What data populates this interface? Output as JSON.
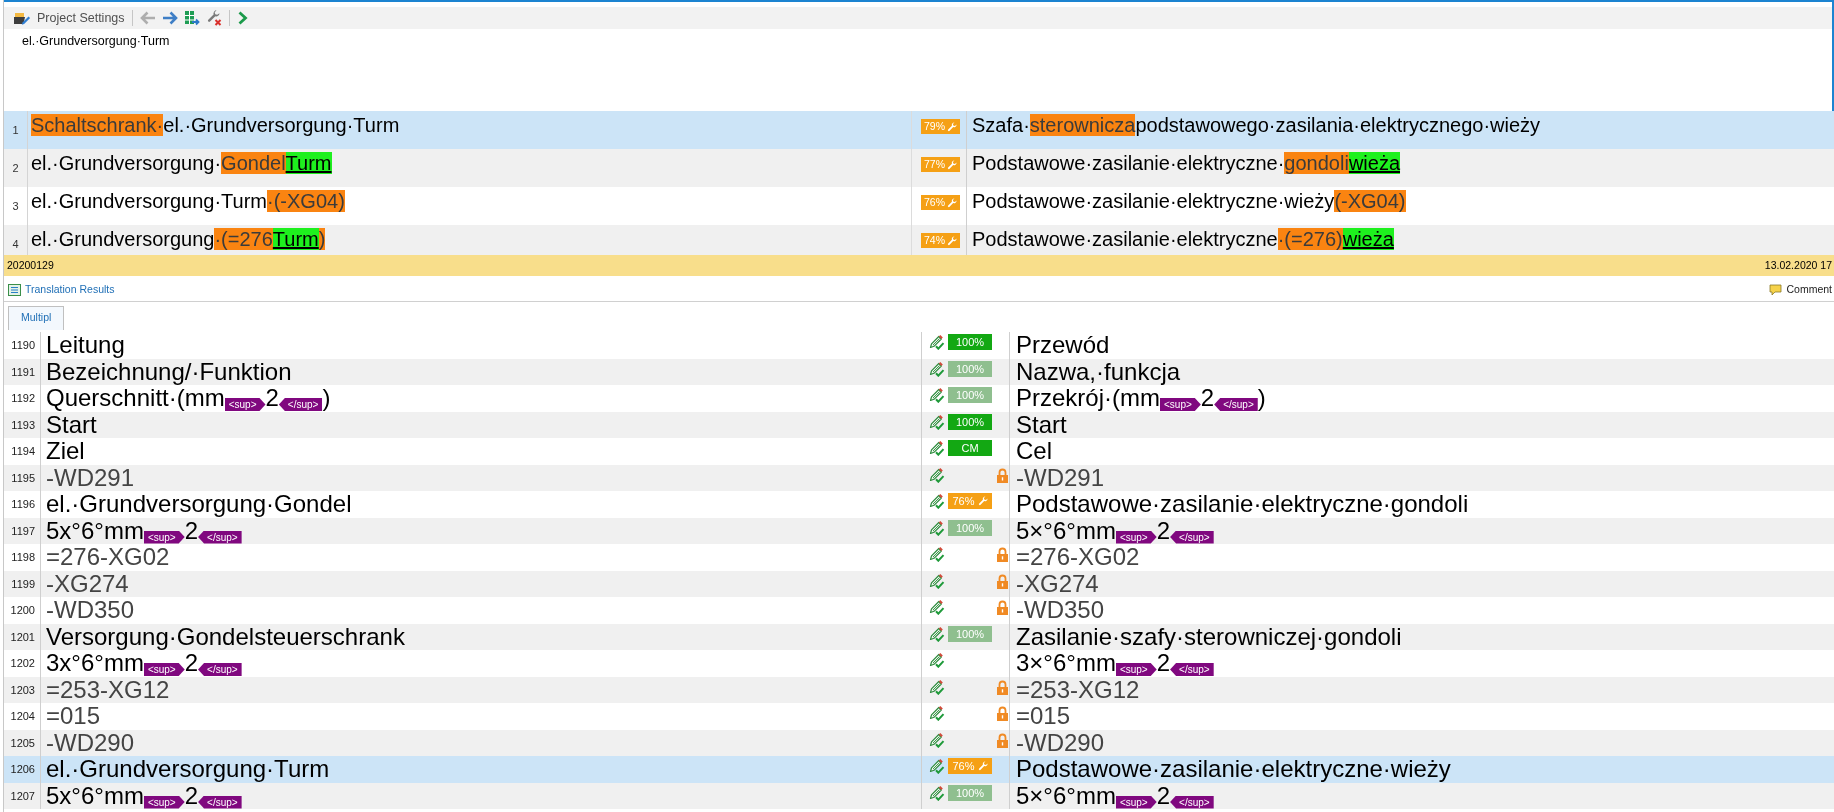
{
  "toolbar": {
    "settings_label": "Project Settings",
    "buttons": [
      {
        "kind": "back",
        "disabled": true
      },
      {
        "kind": "forward",
        "disabled": false
      },
      {
        "kind": "apply",
        "disabled": false
      },
      {
        "kind": "remove",
        "disabled": false
      },
      {
        "kind": "next",
        "disabled": false
      }
    ]
  },
  "source_preview": "el.·Grundversorgung·Turm",
  "results": [
    {
      "number": "1",
      "selected": true,
      "source": [
        {
          "kind": "changed",
          "text": "Schaltschrank·"
        },
        {
          "kind": "plain",
          "text": "el.·Grundversorgung·Turm"
        }
      ],
      "score": {
        "kind": "fuzzy",
        "text": "79%"
      },
      "target": [
        {
          "kind": "plain",
          "text": "Szafa·"
        },
        {
          "kind": "changed",
          "text": "sterownicza"
        },
        {
          "kind": "plain",
          "text": "podstawowego·zasilania·elektrycznego·wieży"
        }
      ]
    },
    {
      "number": "2",
      "selected": false,
      "source": [
        {
          "kind": "plain",
          "text": "el.·Grundversorgung·"
        },
        {
          "kind": "changed",
          "text": "Gondel"
        },
        {
          "kind": "inserted",
          "text": "Turm"
        }
      ],
      "score": {
        "kind": "fuzzy",
        "text": "77%"
      },
      "target": [
        {
          "kind": "plain",
          "text": "Podstawowe·zasilanie·elektryczne·"
        },
        {
          "kind": "changed",
          "text": "gondoli"
        },
        {
          "kind": "inserted",
          "text": "wieża"
        }
      ]
    },
    {
      "number": "3",
      "selected": false,
      "source": [
        {
          "kind": "plain",
          "text": "el.·Grundversorgung·Turm"
        },
        {
          "kind": "changed",
          "text": "·(-XG04)"
        }
      ],
      "score": {
        "kind": "fuzzy",
        "text": "76%"
      },
      "target": [
        {
          "kind": "plain",
          "text": "Podstawowe·zasilanie·elektryczne·wieży"
        },
        {
          "kind": "changed",
          "text": "(-XG04)"
        }
      ]
    },
    {
      "number": "4",
      "selected": false,
      "source": [
        {
          "kind": "plain",
          "text": "el.·Grundversorgung"
        },
        {
          "kind": "changed",
          "text": "·(=276"
        },
        {
          "kind": "inserted",
          "text": "Turm"
        },
        {
          "kind": "changed",
          "text": ")"
        }
      ],
      "score": {
        "kind": "fuzzy",
        "text": "74%"
      },
      "target": [
        {
          "kind": "plain",
          "text": "Podstawowe·zasilanie·elektryczne"
        },
        {
          "kind": "changed",
          "text": "·(=276)"
        },
        {
          "kind": "inserted",
          "text": "wieża"
        }
      ]
    }
  ],
  "info_bar": {
    "segment_id": "20200129",
    "date": "13.02.2020 17"
  },
  "panel_tabs": [
    {
      "label": "Translation Results",
      "selected": true
    },
    {
      "label": "Comment",
      "selected": false
    }
  ],
  "document_tabs": [
    {
      "label": "Multipl",
      "selected": true
    }
  ],
  "segments": [
    {
      "number": "1190",
      "selected": false,
      "locked": false,
      "source": [
        {
          "kind": "plain",
          "text": "Leitung"
        }
      ],
      "badge": {
        "kind": "exact",
        "text": "100%",
        "color": "#13a813"
      },
      "target": [
        {
          "kind": "plain",
          "text": "Przewód"
        }
      ]
    },
    {
      "number": "1191",
      "selected": false,
      "locked": false,
      "source": [
        {
          "kind": "plain",
          "text": "Bezeichnung/·Funktion"
        }
      ],
      "badge": {
        "kind": "exact",
        "text": "100%",
        "color": "#8fbf8f"
      },
      "target": [
        {
          "kind": "plain",
          "text": "Nazwa,·funkcja"
        }
      ]
    },
    {
      "number": "1192",
      "selected": false,
      "locked": false,
      "source": [
        {
          "kind": "plain",
          "text": "Querschnitt·(mm"
        },
        {
          "kind": "tag_open",
          "text": "<sup>"
        },
        {
          "kind": "plain",
          "text": "2"
        },
        {
          "kind": "tag_close",
          "text": "</sup>"
        },
        {
          "kind": "plain",
          "text": ")"
        }
      ],
      "badge": {
        "kind": "exact",
        "text": "100%",
        "color": "#8fbf8f"
      },
      "target": [
        {
          "kind": "plain",
          "text": "Przekrój·(mm"
        },
        {
          "kind": "tag_open",
          "text": "<sup>"
        },
        {
          "kind": "plain",
          "text": "2"
        },
        {
          "kind": "tag_close",
          "text": "</sup>"
        },
        {
          "kind": "plain",
          "text": ")"
        }
      ]
    },
    {
      "number": "1193",
      "selected": false,
      "locked": false,
      "source": [
        {
          "kind": "plain",
          "text": "Start"
        }
      ],
      "badge": {
        "kind": "exact",
        "text": "100%",
        "color": "#13a813"
      },
      "target": [
        {
          "kind": "plain",
          "text": "Start"
        }
      ]
    },
    {
      "number": "1194",
      "selected": false,
      "locked": false,
      "source": [
        {
          "kind": "plain",
          "text": "Ziel"
        }
      ],
      "badge": {
        "kind": "exact",
        "text": "CM",
        "color": "#13a813"
      },
      "target": [
        {
          "kind": "plain",
          "text": "Cel"
        }
      ]
    },
    {
      "number": "1195",
      "selected": false,
      "locked": true,
      "source": [
        {
          "kind": "plain",
          "text": "-WD291"
        }
      ],
      "target": [
        {
          "kind": "plain",
          "text": "-WD291"
        }
      ]
    },
    {
      "number": "1196",
      "selected": false,
      "locked": false,
      "source": [
        {
          "kind": "plain",
          "text": "el.·Grundversorgung·Gondel"
        }
      ],
      "badge": {
        "kind": "fuzzy",
        "text": "76%",
        "color": "#f5a015"
      },
      "target": [
        {
          "kind": "plain",
          "text": "Podstawowe·zasilanie·elektryczne·gondoli"
        }
      ]
    },
    {
      "number": "1197",
      "selected": false,
      "locked": false,
      "source": [
        {
          "kind": "plain",
          "text": "5x°6°mm"
        },
        {
          "kind": "tag_open",
          "text": "<sup>"
        },
        {
          "kind": "plain",
          "text": "2"
        },
        {
          "kind": "tag_close",
          "text": "</sup>"
        }
      ],
      "badge": {
        "kind": "exact",
        "text": "100%",
        "color": "#8fbf8f"
      },
      "target": [
        {
          "kind": "plain",
          "text": "5×°6°mm"
        },
        {
          "kind": "tag_open",
          "text": "<sup>"
        },
        {
          "kind": "plain",
          "text": "2"
        },
        {
          "kind": "tag_close",
          "text": "</sup>"
        }
      ]
    },
    {
      "number": "1198",
      "selected": false,
      "locked": true,
      "source": [
        {
          "kind": "plain",
          "text": "=276-XG02"
        }
      ],
      "target": [
        {
          "kind": "plain",
          "text": "=276-XG02"
        }
      ]
    },
    {
      "number": "1199",
      "selected": false,
      "locked": true,
      "source": [
        {
          "kind": "plain",
          "text": "-XG274"
        }
      ],
      "target": [
        {
          "kind": "plain",
          "text": "-XG274"
        }
      ]
    },
    {
      "number": "1200",
      "selected": false,
      "locked": true,
      "source": [
        {
          "kind": "plain",
          "text": "-WD350"
        }
      ],
      "target": [
        {
          "kind": "plain",
          "text": "-WD350"
        }
      ]
    },
    {
      "number": "1201",
      "selected": false,
      "locked": false,
      "source": [
        {
          "kind": "plain",
          "text": "Versorgung·Gondelsteuerschrank"
        }
      ],
      "badge": {
        "kind": "exact",
        "text": "100%",
        "color": "#8fbf8f"
      },
      "target": [
        {
          "kind": "plain",
          "text": "Zasilanie·szafy·sterowniczej·gondoli"
        }
      ]
    },
    {
      "number": "1202",
      "selected": false,
      "locked": false,
      "source": [
        {
          "kind": "plain",
          "text": "3x°6°mm"
        },
        {
          "kind": "tag_open",
          "text": "<sup>"
        },
        {
          "kind": "plain",
          "text": "2"
        },
        {
          "kind": "tag_close",
          "text": "</sup>"
        }
      ],
      "target": [
        {
          "kind": "plain",
          "text": "3×°6°mm"
        },
        {
          "kind": "tag_open",
          "text": "<sup>"
        },
        {
          "kind": "plain",
          "text": "2"
        },
        {
          "kind": "tag_close",
          "text": "</sup>"
        }
      ]
    },
    {
      "number": "1203",
      "selected": false,
      "locked": true,
      "source": [
        {
          "kind": "plain",
          "text": "=253-XG12"
        }
      ],
      "target": [
        {
          "kind": "plain",
          "text": "=253-XG12"
        }
      ]
    },
    {
      "number": "1204",
      "selected": false,
      "locked": true,
      "source": [
        {
          "kind": "plain",
          "text": "=015"
        }
      ],
      "target": [
        {
          "kind": "plain",
          "text": "=015"
        }
      ]
    },
    {
      "number": "1205",
      "selected": false,
      "locked": true,
      "source": [
        {
          "kind": "plain",
          "text": "-WD290"
        }
      ],
      "target": [
        {
          "kind": "plain",
          "text": "-WD290"
        }
      ]
    },
    {
      "number": "1206",
      "selected": true,
      "locked": false,
      "source": [
        {
          "kind": "plain",
          "text": "el.·Grundversorgung·Turm"
        }
      ],
      "badge": {
        "kind": "fuzzy",
        "text": "76%",
        "color": "#f5a015"
      },
      "target": [
        {
          "kind": "plain",
          "text": "Podstawowe·zasilanie·elektryczne·wieży"
        }
      ]
    },
    {
      "number": "1207",
      "selected": false,
      "locked": false,
      "source": [
        {
          "kind": "plain",
          "text": "5x°6°mm"
        },
        {
          "kind": "tag_open",
          "text": "<sup>"
        },
        {
          "kind": "plain",
          "text": "2"
        },
        {
          "kind": "tag_close",
          "text": "</sup>"
        }
      ],
      "badge": {
        "kind": "exact",
        "text": "100%",
        "color": "#8fbf8f"
      },
      "target": [
        {
          "kind": "plain",
          "text": "5×°6°mm"
        },
        {
          "kind": "tag_open",
          "text": "<sup>"
        },
        {
          "kind": "plain",
          "text": "2"
        },
        {
          "kind": "tag_close",
          "text": "</sup>"
        }
      ]
    }
  ]
}
